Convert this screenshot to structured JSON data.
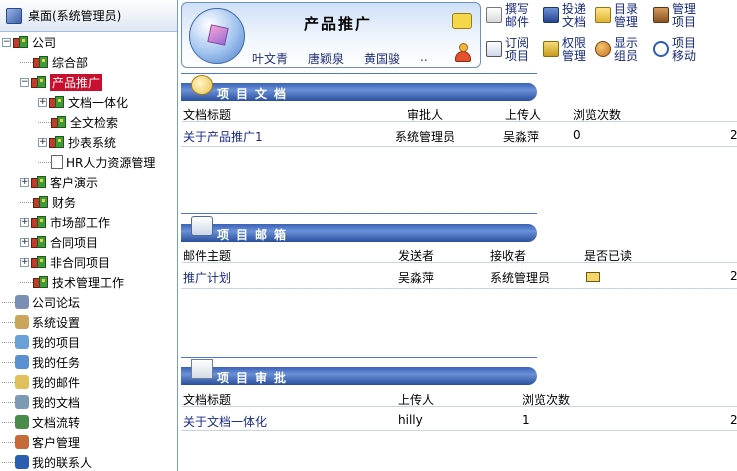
{
  "tree": {
    "root": "桌面(系统管理员)",
    "items": [
      {
        "label": "公司",
        "level": 0,
        "expander": "minus"
      },
      {
        "label": "综合部",
        "level": 1,
        "expander": ""
      },
      {
        "label": "产品推广",
        "level": 1,
        "expander": "minus",
        "selected": true
      },
      {
        "label": "文档一体化",
        "level": 2,
        "expander": "plus"
      },
      {
        "label": "全文检索",
        "level": 2,
        "expander": ""
      },
      {
        "label": "抄表系统",
        "level": 2,
        "expander": "plus"
      },
      {
        "label": "HR人力资源管理",
        "level": 2,
        "expander": ""
      },
      {
        "label": "客户演示",
        "level": 1,
        "expander": "plus"
      },
      {
        "label": "财务",
        "level": 1,
        "expander": ""
      },
      {
        "label": "市场部工作",
        "level": 1,
        "expander": "plus"
      },
      {
        "label": "合同项目",
        "level": 1,
        "expander": "plus"
      },
      {
        "label": "非合同项目",
        "level": 1,
        "expander": "plus"
      },
      {
        "label": "技术管理工作",
        "level": 1,
        "expander": ""
      },
      {
        "label": "公司论坛",
        "level": 0,
        "expander": ""
      },
      {
        "label": "系统设置",
        "level": 0,
        "expander": ""
      },
      {
        "label": "我的项目",
        "level": 0,
        "expander": ""
      },
      {
        "label": "我的任务",
        "level": 0,
        "expander": ""
      },
      {
        "label": "我的邮件",
        "level": 0,
        "expander": ""
      },
      {
        "label": "我的文档",
        "level": 0,
        "expander": ""
      },
      {
        "label": "文档流转",
        "level": 0,
        "expander": ""
      },
      {
        "label": "客户管理",
        "level": 0,
        "expander": ""
      },
      {
        "label": "我的联系人",
        "level": 0,
        "expander": ""
      }
    ]
  },
  "banner": {
    "title": "产品推广",
    "users": [
      "叶文青",
      "唐颖泉",
      "黄国骏",
      ".."
    ]
  },
  "toolbar": {
    "compose_mail": "撰写邮件",
    "submit_doc": "投递文档",
    "dir_manage": "目录管理",
    "manage_project": "管理项目",
    "subscribe_project": "订阅项目",
    "permission_manage": "权限管理",
    "show_members": "显示组员",
    "move_project": "项目移动"
  },
  "sections": {
    "docs": {
      "title": "项目文档",
      "headers": [
        "文档标题",
        "审批人",
        "上传人",
        "浏览次数"
      ],
      "rows": [
        {
          "title": "关于产品推广1",
          "approver": "系统管理员",
          "uploader": "吴淼萍",
          "views": "0",
          "extra": "2"
        }
      ]
    },
    "mail": {
      "title": "项目邮箱",
      "headers": [
        "邮件主题",
        "发送者",
        "接收者",
        "是否已读"
      ],
      "rows": [
        {
          "subject": "推广计划",
          "sender": "吴淼萍",
          "receiver": "系统管理员",
          "read_icon": "envelope-icon",
          "extra": "2"
        }
      ]
    },
    "approval": {
      "title": "项目审批",
      "headers": [
        "文档标题",
        "上传人",
        "浏览次数"
      ],
      "rows": [
        {
          "title": "关于文档一体化",
          "uploader": "hilly",
          "views": "1",
          "extra": "2"
        }
      ]
    }
  },
  "colors": {
    "section_bar": "#3b63b6",
    "link_text": "#1a2a8c",
    "selected_bg": "#c8102e"
  }
}
